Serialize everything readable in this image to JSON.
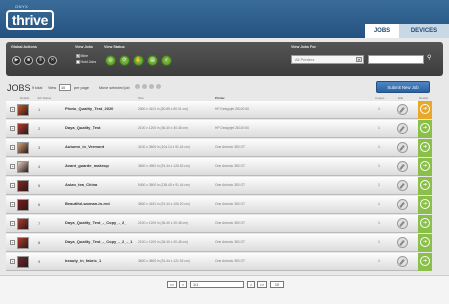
{
  "header": {
    "logo_pre": "ONYX",
    "logo_text": "thrive",
    "tabs": [
      {
        "label": "JOBS",
        "active": true
      },
      {
        "label": "DEVICES",
        "active": false
      }
    ]
  },
  "toolbar": {
    "global_actions_label": "Global Actions",
    "global_icons": [
      "play-icon",
      "stop-icon",
      "pause-icon",
      "close-icon"
    ],
    "view_jobs_label": "View Jobs",
    "view_jobs_options": [
      {
        "label": "Mine",
        "checked": true
      },
      {
        "label": "Hold Jobs",
        "checked": false
      }
    ],
    "view_status_label": "View Status",
    "status_icons": [
      "status-all-icon",
      "status-ripping-icon",
      "status-hold-icon",
      "status-printing-icon",
      "status-done-icon"
    ],
    "view_jobs_for_label": "View Jobs For",
    "printer_select": "All Printers",
    "search_value": ""
  },
  "jobs": {
    "title": "JOBS",
    "total": "9 total",
    "view_label": "View",
    "per_page_value": "10",
    "per_page_label": "per page",
    "move_selected_label": "Move selected job",
    "submit_label": "Submit New Job"
  },
  "table": {
    "headers": {
      "thumb": "Details",
      "num": "Job Status",
      "size": "Size",
      "printer": "Printer",
      "copies": "Copies",
      "edit": "Edit",
      "status": "Details"
    },
    "rows": [
      {
        "num": "1",
        "name": "Photo_Quality_Test_2020",
        "size": "2600 x 4101 in (50.85 x 80.01 cm)",
        "printer": "HP Designjet Z6100 60",
        "copies": "1",
        "thumb": "#c95a2d"
      },
      {
        "num": "2",
        "name": "Daya_Quality_Test",
        "size": "2100 x 1200 in (36.40 x 30.48 cm)",
        "printer": "HP Designjet Z6100 60",
        "copies": "1",
        "thumb": "#b23b2a"
      },
      {
        "num": "3",
        "name": "Autumn_in_Vermont",
        "size": "4100 x 3600 in (104.14 x 91.44 cm)",
        "printer": "One Antonio 350 GT",
        "copies": "1",
        "thumb": "#d4a27a"
      },
      {
        "num": "4",
        "name": "Avant_guarde_makeup",
        "size": "3600 x 4981 in (91.44 x 126.52 cm)",
        "printer": "One Antonio 350 GT",
        "copies": "1",
        "thumb": "#e4cdbc"
      },
      {
        "num": "5",
        "name": "Asian_tea_China",
        "size": "5400 x 3600 in (138.45 x 91.44 cm)",
        "printer": "One Antonio 350 GT",
        "copies": "1",
        "thumb": "#8a2520"
      },
      {
        "num": "6",
        "name": "Beautiful-woman-in-red",
        "size": "3600 x 4181 in (91.44 x 106.20 cm)",
        "printer": "One Antonio 350 GT",
        "copies": "1",
        "thumb": "#7d1b1b"
      },
      {
        "num": "7",
        "name": "Daya_Quality_Test_-_Copy_-_2_",
        "size": "2100 x 1200 in (36.40 x 30.48 cm)",
        "printer": "One Antonio 350 GT",
        "copies": "1",
        "thumb": "#b23b2a"
      },
      {
        "num": "8",
        "name": "Daya_Quality_Test_-_Copy_-_2_-_1",
        "size": "2100 x 1200 in (36.40 x 30.48 cm)",
        "printer": "One Antonio 350 GT",
        "copies": "1",
        "thumb": "#b23b2a"
      },
      {
        "num": "9",
        "name": "beauty_in_fabric_1",
        "size": "3600 x 4800 in (91.44 x 121.92 cm)",
        "printer": "One Antonio 350 GT",
        "copies": "1",
        "thumb": "#6c2a2a"
      }
    ]
  },
  "pager": {
    "first": "<<",
    "prev": "<",
    "page_value": "1/1",
    "next": ">",
    "last": ">>",
    "per_page": "10"
  },
  "colors": {
    "header_blue": "#2d5d8a",
    "first_status": "#e7a92b",
    "status_green": "#8abf4a",
    "submit_blue": "#2a60a0"
  }
}
